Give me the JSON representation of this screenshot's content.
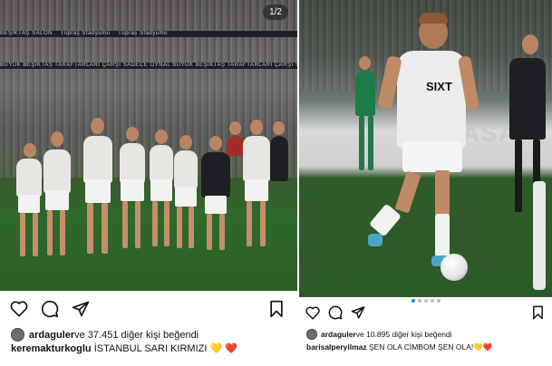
{
  "left_post": {
    "photo_counter": "1/2",
    "stand_banners": [
      "BEŞİKTAŞ SALON",
      "Tüpraş Stadyumu",
      "Tüpraş Stadyumu"
    ],
    "stand_banner_lower": "BÜYÜK BEŞİKTAŞ TARAFTARLARI ÇARŞI SADECE OYNAL BÜYÜK BEŞİKTAŞ TARAFTARLARI ÇARŞI SADECE OYNAL",
    "likes": {
      "user": "ardaguler",
      "text": " ve 37.451 diğer kişi beğendi"
    },
    "caption": {
      "user": "keremakturkoglu",
      "text": " İSTANBUL SARI KIRMIZI ",
      "emoji_1": "💛",
      "emoji_2": "❤️"
    }
  },
  "right_post": {
    "sponsor_text": "ASA",
    "shirt_sponsor": "SIXT",
    "likes": {
      "user": "ardaguler",
      "text": " ve 10.895 diğer kişi beğendi"
    },
    "caption": {
      "user": "barisalperyilmaz",
      "text": " ŞEN OLA CİMBOM ŞEN OLA!",
      "emoji_1": "💛",
      "emoji_2": "❤️"
    }
  },
  "icons": [
    "heart-icon",
    "comment-icon",
    "share-icon",
    "bookmark-icon"
  ]
}
